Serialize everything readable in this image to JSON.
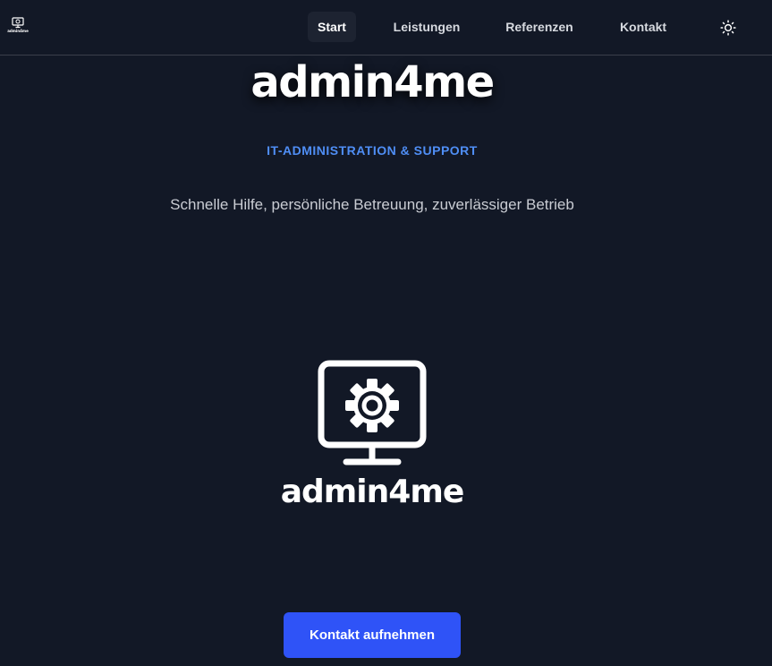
{
  "header": {
    "logo_text": "admin4me",
    "nav": [
      {
        "label": "Start",
        "active": true
      },
      {
        "label": "Leistungen",
        "active": false
      },
      {
        "label": "Referenzen",
        "active": false
      },
      {
        "label": "Kontakt",
        "active": false
      }
    ],
    "theme_toggle_icon": "sun-icon"
  },
  "hero": {
    "title": "admin4me",
    "subtitle": "IT-ADMINISTRATION & SUPPORT",
    "tagline": "Schnelle Hilfe, persönliche Betreuung, zuverlässiger Betrieb"
  },
  "brand": {
    "icon": "monitor-gear-icon",
    "name": "admin4me"
  },
  "cta": {
    "label": "Kontakt aufnehmen"
  },
  "colors": {
    "background": "#121826",
    "accent": "#4f8ef5",
    "button": "#2f53f7",
    "nav_active_bg": "#1d2331"
  }
}
